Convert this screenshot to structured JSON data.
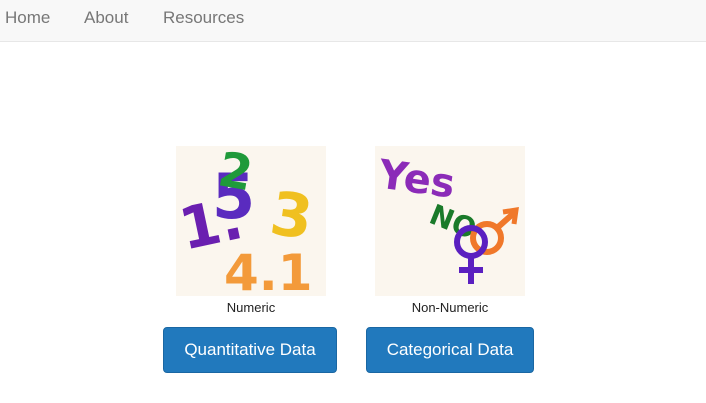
{
  "nav": {
    "items": [
      {
        "label": "Home"
      },
      {
        "label": "About"
      },
      {
        "label": "Resources"
      }
    ]
  },
  "cards": [
    {
      "image_text": [
        "1.",
        "5",
        "2",
        "3",
        "4.1"
      ],
      "caption": "Numeric",
      "button_label": "Quantitative Data"
    },
    {
      "image_text": [
        "Yes",
        "NO"
      ],
      "image_symbols": [
        "male-symbol",
        "female-symbol"
      ],
      "caption": "Non-Numeric",
      "button_label": "Categorical Data"
    }
  ],
  "colors": {
    "navbar_bg": "#f8f8f8",
    "nav_link": "#777777",
    "button_bg": "#2179bd",
    "button_text": "#ffffff"
  }
}
